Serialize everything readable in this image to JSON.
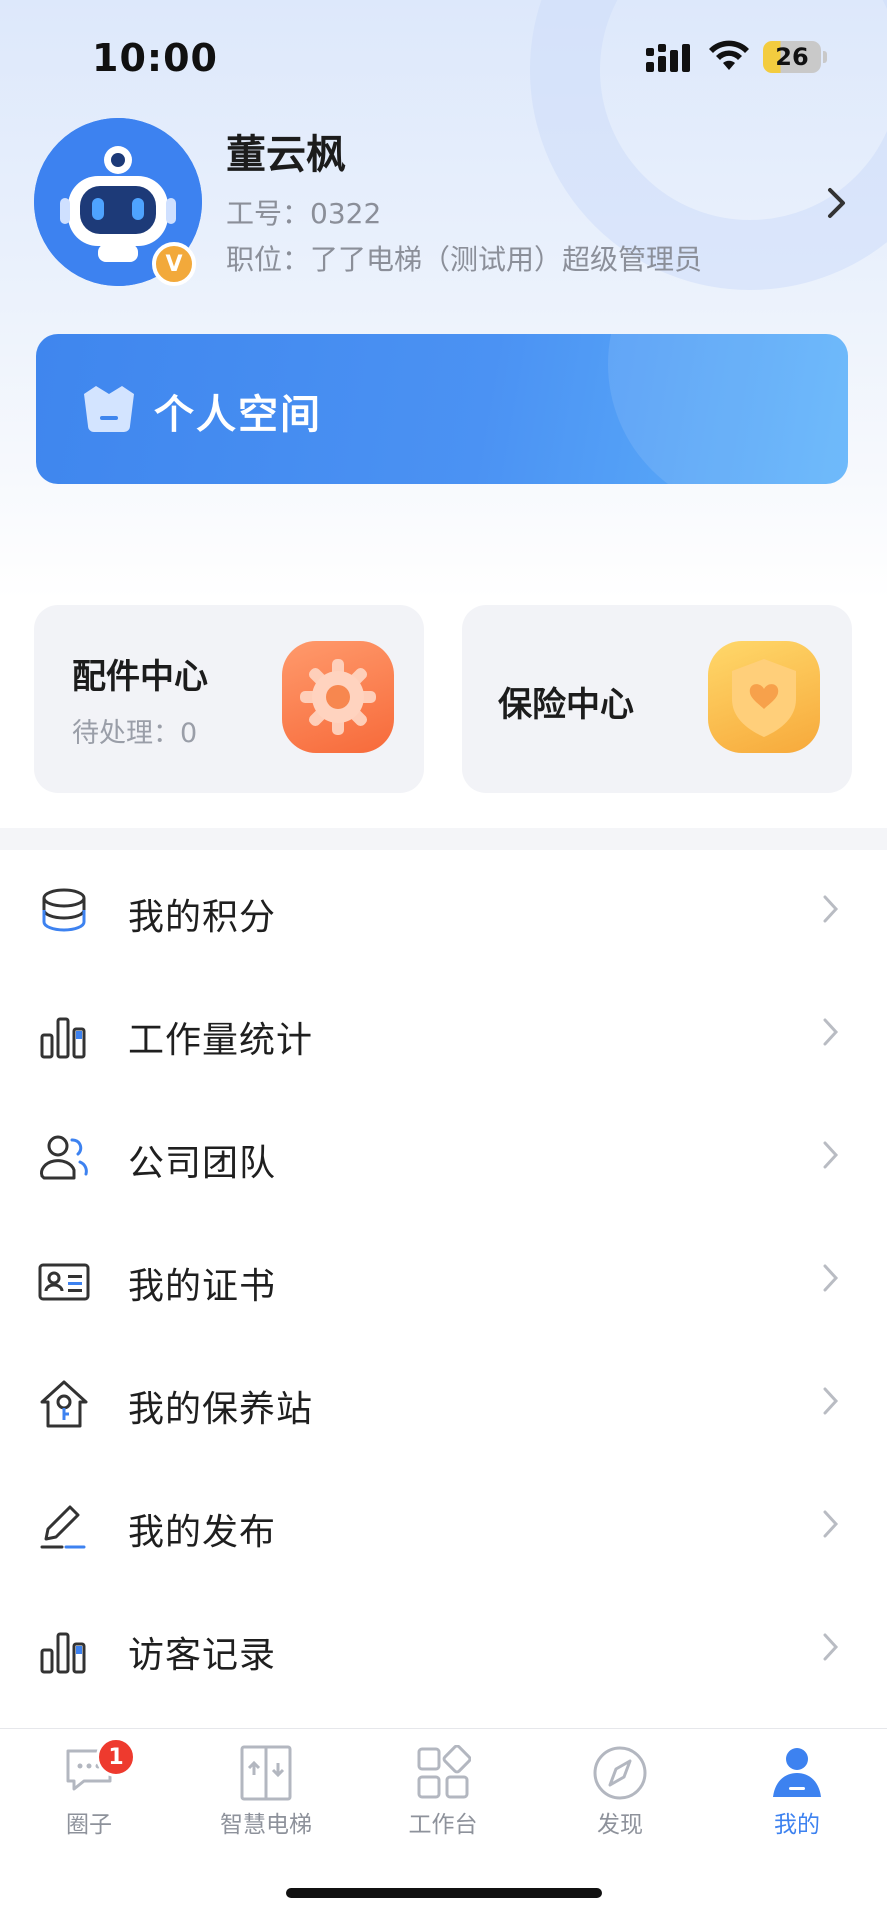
{
  "status_bar": {
    "time": "10:00",
    "battery": "26"
  },
  "profile": {
    "name": "董云枫",
    "employee_id": "工号：0322",
    "position": "职位：了了电梯（测试用）超级管理员",
    "badge": "V"
  },
  "banner": {
    "label": "个人空间"
  },
  "cards": {
    "parts": {
      "title": "配件中心",
      "subtitle": "待处理：0"
    },
    "insurance": {
      "title": "保险中心"
    }
  },
  "menu": [
    {
      "label": "我的积分",
      "icon": "coins-icon"
    },
    {
      "label": "工作量统计",
      "icon": "bar-chart-icon"
    },
    {
      "label": "公司团队",
      "icon": "team-icon"
    },
    {
      "label": "我的证书",
      "icon": "id-card-icon"
    },
    {
      "label": "我的保养站",
      "icon": "home-key-icon"
    },
    {
      "label": "我的发布",
      "icon": "edit-icon"
    },
    {
      "label": "访客记录",
      "icon": "bar-chart-icon"
    }
  ],
  "tabs": [
    {
      "label": "圈子",
      "badge": "1",
      "active": false
    },
    {
      "label": "智慧电梯",
      "active": false
    },
    {
      "label": "工作台",
      "active": false
    },
    {
      "label": "发现",
      "active": false
    },
    {
      "label": "我的",
      "active": true
    }
  ],
  "colors": {
    "accent": "#3d82f0",
    "badge": "#ee3a2e",
    "parts_card": "#f76a3a",
    "insurance_card": "#f7a93b"
  }
}
